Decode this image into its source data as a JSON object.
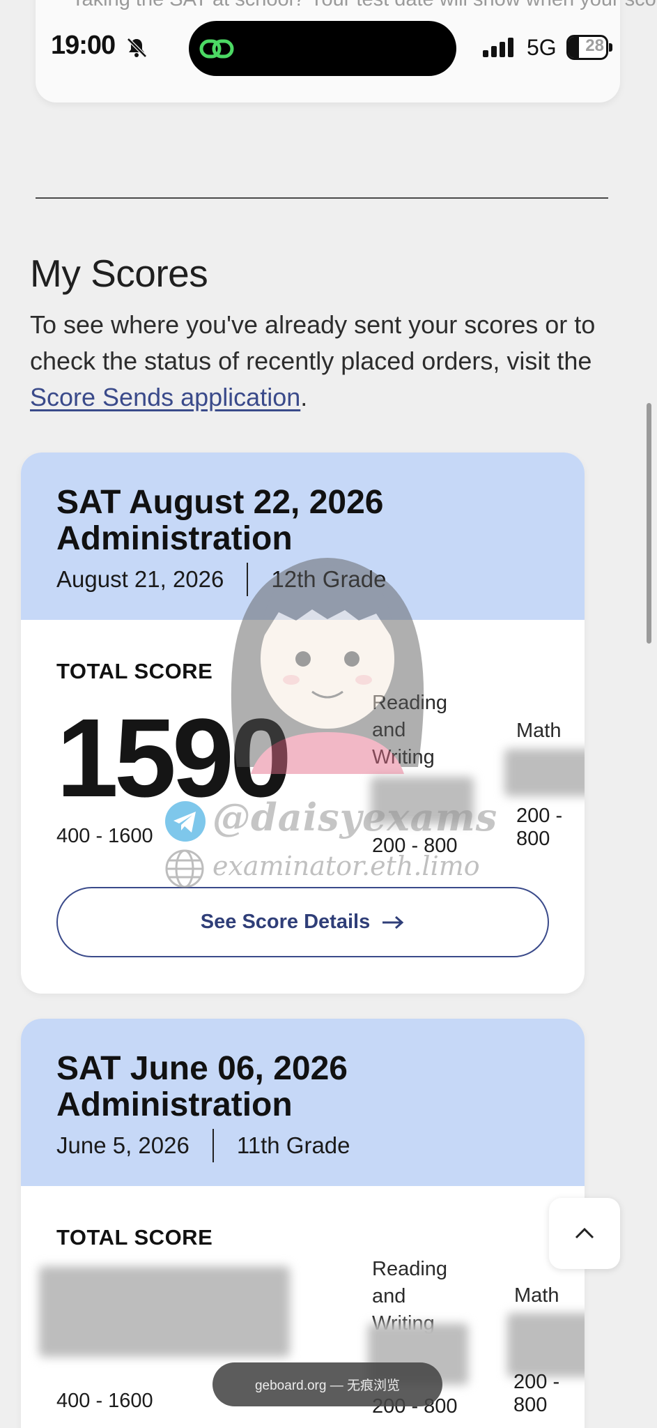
{
  "notice": {
    "text": "Taking the SAT at school? Your test date will show when your scores"
  },
  "status_bar": {
    "time": "19:00",
    "network": "5G",
    "battery_level": "28",
    "battery_fraction": 0.28
  },
  "my_scores": {
    "title": "My Scores",
    "description_before_link": "To see where you've already sent your scores or to check the status of recently placed orders, visit the ",
    "link_label": "Score Sends application",
    "description_after_link": "."
  },
  "cards": [
    {
      "title": "SAT August 22, 2026 Administration",
      "date": "August 21, 2026",
      "grade": "12th Grade",
      "total_label": "TOTAL SCORE",
      "total_value": "1590",
      "total_range": "400 - 1600",
      "rw_label": "Reading and Writing",
      "rw_range": "200 - 800",
      "math_label": "Math",
      "math_range": "200 - 800",
      "button_label": "See Score Details"
    },
    {
      "title": "SAT June 06, 2026 Administration",
      "date": "June 5, 2026",
      "grade": "11th Grade",
      "total_label": "TOTAL SCORE",
      "total_range": "400 - 1600",
      "rw_label": "Reading and Writing",
      "rw_range": "200 - 800",
      "math_label": "Math",
      "math_range": "200 - 800"
    }
  ],
  "url_bar": {
    "text": "geboard.org — 无痕浏览"
  },
  "watermark": {
    "handle": "@daisyexams",
    "site": "examinator.eth.limo"
  },
  "colors": {
    "card_header": "#c6d8f7",
    "link": "#3a4a8a",
    "background": "#efefef"
  }
}
